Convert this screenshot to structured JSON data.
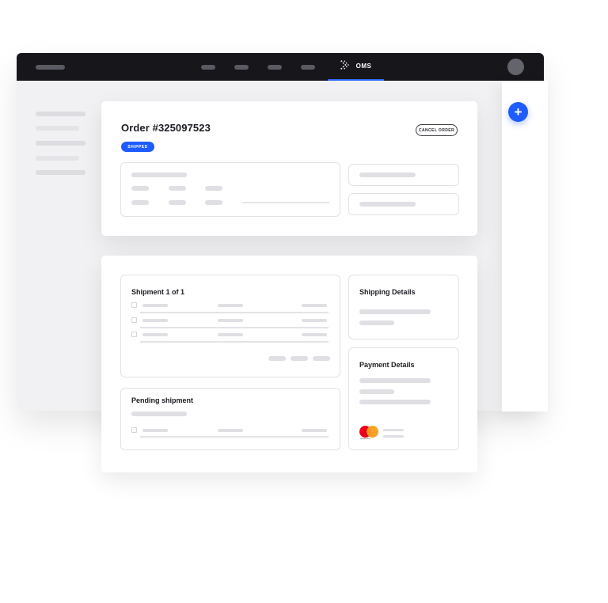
{
  "topbar": {
    "active_tab_label": "OMS"
  },
  "order": {
    "title": "Order #325097523",
    "status": "SHIPPED",
    "cancel_label": "CANCEL ORDER"
  },
  "shipment": {
    "title": "Shipment 1 of 1",
    "pending_title": "Pending shipment"
  },
  "details": {
    "shipping_title": "Shipping Details",
    "payment_title": "Payment Details",
    "card_brand": "mastercard"
  },
  "colors": {
    "accent": "#1f5cff",
    "topbar": "#16161b",
    "mastercard_red": "#eb001b",
    "mastercard_yellow": "#f79e1b"
  },
  "icons": {
    "app_logo": "oms-logo-icon",
    "add": "plus-icon",
    "checkbox": "checkbox-icon"
  }
}
